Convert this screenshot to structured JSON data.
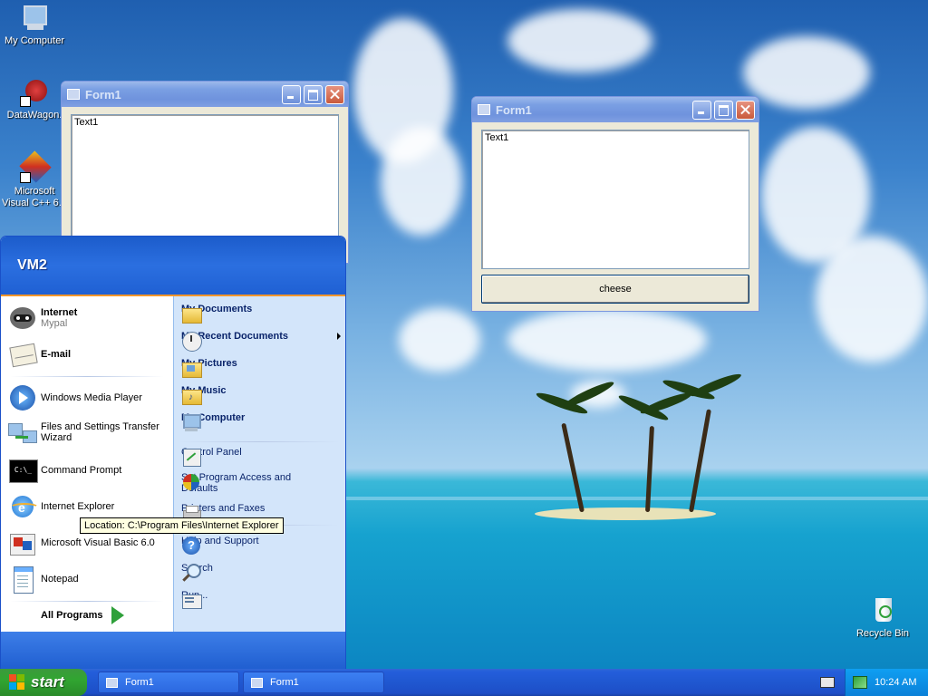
{
  "desktop": {
    "icons": [
      {
        "label": "My Computer"
      },
      {
        "label": "DataWagon."
      },
      {
        "label": "Microsoft Visual C++ 6.0"
      },
      {
        "label": "Recycle Bin"
      }
    ]
  },
  "windows": [
    {
      "title": "Form1",
      "textbox": "Text1"
    },
    {
      "title": "Form1",
      "textbox": "Text1",
      "button": "cheese"
    }
  ],
  "start_menu": {
    "user": "VM2",
    "pinned": [
      {
        "label": "Internet",
        "sub": "Mypal"
      },
      {
        "label": "E-mail"
      }
    ],
    "recent": [
      {
        "label": "Windows Media Player"
      },
      {
        "label": "Files and Settings Transfer Wizard"
      },
      {
        "label": "Command Prompt"
      },
      {
        "label": "Internet Explorer"
      },
      {
        "label": "Microsoft Visual Basic 6.0"
      },
      {
        "label": "Notepad"
      }
    ],
    "all_programs": "All Programs",
    "right": [
      {
        "label": "My Documents"
      },
      {
        "label": "My Recent Documents"
      },
      {
        "label": "My Pictures"
      },
      {
        "label": "My Music"
      },
      {
        "label": "My Computer"
      },
      {
        "label": "Control Panel"
      },
      {
        "label": "Set Program Access and Defaults"
      },
      {
        "label": "Printers and Faxes"
      },
      {
        "label": "Help and Support"
      },
      {
        "label": "Search"
      },
      {
        "label": "Run..."
      }
    ],
    "tooltip": "Location: C:\\Program Files\\Internet Explorer"
  },
  "taskbar": {
    "start": "start",
    "items": [
      {
        "label": "Form1"
      },
      {
        "label": "Form1"
      }
    ],
    "clock": "10:24 AM"
  }
}
